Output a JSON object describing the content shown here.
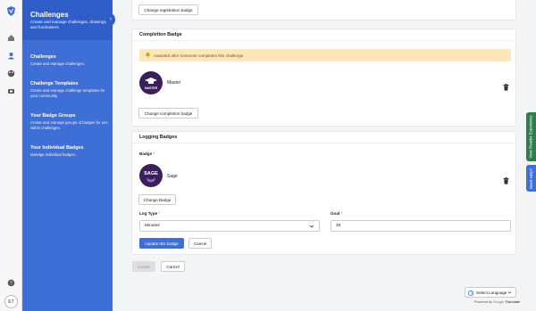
{
  "sidebar": {
    "title": "Challenges",
    "description": "Create and manage challenges, drawings, and fundraisers.",
    "items": [
      {
        "label": "Challenges",
        "sub": "Create and manage challenges."
      },
      {
        "label": "Challenge Templates",
        "sub": "Create and manage challenge templates for your community"
      },
      {
        "label": "Your Badge Groups",
        "sub": "Create and manage groups of badges for use within challenges."
      },
      {
        "label": "Your Individual Badges",
        "sub": "Manage individual badges."
      }
    ]
  },
  "user": {
    "initials": "ET"
  },
  "registration": {
    "change_button": "Change registration badge"
  },
  "completion": {
    "heading": "Completion Badge",
    "notice": "Awarded after someone completes this challenge",
    "badge_name": "Master",
    "badge_text": "MASTER",
    "change_button": "Change completion badge"
  },
  "logging": {
    "heading": "Logging Badges",
    "badge_label": "Badge",
    "required": "*",
    "badge_name": "Sage",
    "badge_text": "SAGE",
    "change_button": "Change Badge",
    "log_type_label": "Log Type",
    "log_type_value": "Minutes",
    "goal_label": "Goal",
    "goal_value": "30",
    "update_button": "Update this badge",
    "cancel_button": "Cancel"
  },
  "footer": {
    "create_button": "Create",
    "cancel_button": "Cancel"
  },
  "right_tabs": {
    "reader": "View Reader Experience",
    "help": "Need Help?"
  },
  "translate": {
    "select": "Select Language",
    "powered_by": "Powered by",
    "provider": "Translate"
  },
  "colors": {
    "brand": "#3e6fd6",
    "notice": "#fde6b8",
    "reader_tab": "#2e7d4f"
  }
}
